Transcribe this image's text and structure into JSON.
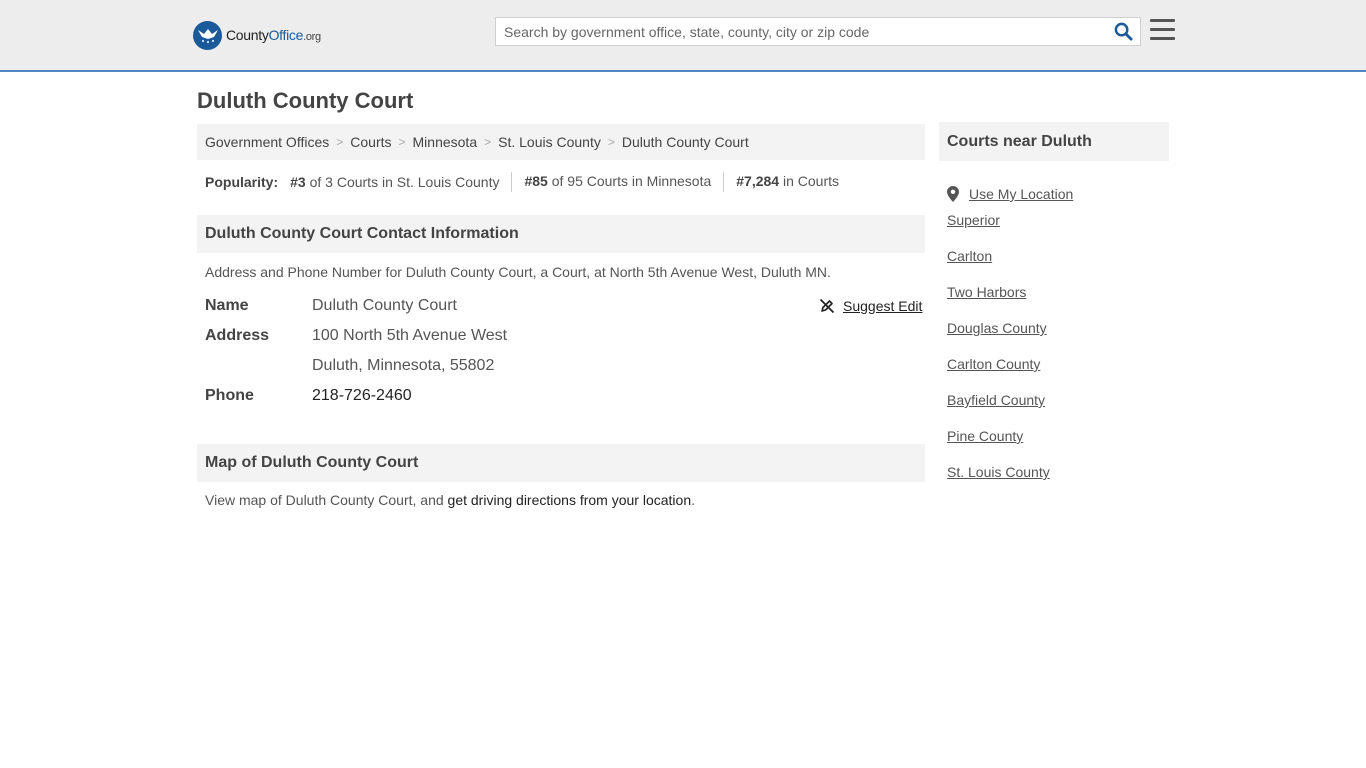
{
  "header": {
    "logo": {
      "part1": "County",
      "part2": "Office",
      "part3": ".org"
    },
    "search_placeholder": "Search by government office, state, county, city or zip code",
    "search_value": ""
  },
  "page_title": "Duluth County Court",
  "breadcrumb": [
    "Government Offices",
    "Courts",
    "Minnesota",
    "St. Louis County",
    "Duluth County Court"
  ],
  "popularity": {
    "label": "Popularity:",
    "items": [
      {
        "rank": "#3",
        "text": "of 3 Courts in St. Louis County"
      },
      {
        "rank": "#85",
        "text": "of 95 Courts in Minnesota"
      },
      {
        "rank": "#7,284",
        "text": "in Courts"
      }
    ]
  },
  "contact": {
    "heading": "Duluth County Court Contact Information",
    "description": "Address and Phone Number for Duluth County Court, a Court, at North 5th Avenue West, Duluth MN.",
    "suggest_edit": "Suggest Edit",
    "name_label": "Name",
    "name_value": "Duluth County Court",
    "address_label": "Address",
    "address_line1": "100 North 5th Avenue West",
    "address_line2": "Duluth, Minnesota, 55802",
    "phone_label": "Phone",
    "phone_value": "218-726-2460"
  },
  "map": {
    "heading": "Map of Duluth County Court",
    "description_prefix": "View map of Duluth County Court, and ",
    "directions_link": "get driving directions from your location",
    "description_suffix": "."
  },
  "sidebar": {
    "heading": "Courts near Duluth",
    "use_location": "Use My Location",
    "items": [
      "Superior",
      "Carlton",
      "Two Harbors",
      "Douglas County",
      "Carlton County",
      "Bayfield County",
      "Pine County",
      "St. Louis County"
    ]
  },
  "colors": {
    "accent": "#4c87c2",
    "logo_blue": "#1b5a9a",
    "header_bg": "#ededed",
    "panel_bg": "#f3f3f3"
  }
}
